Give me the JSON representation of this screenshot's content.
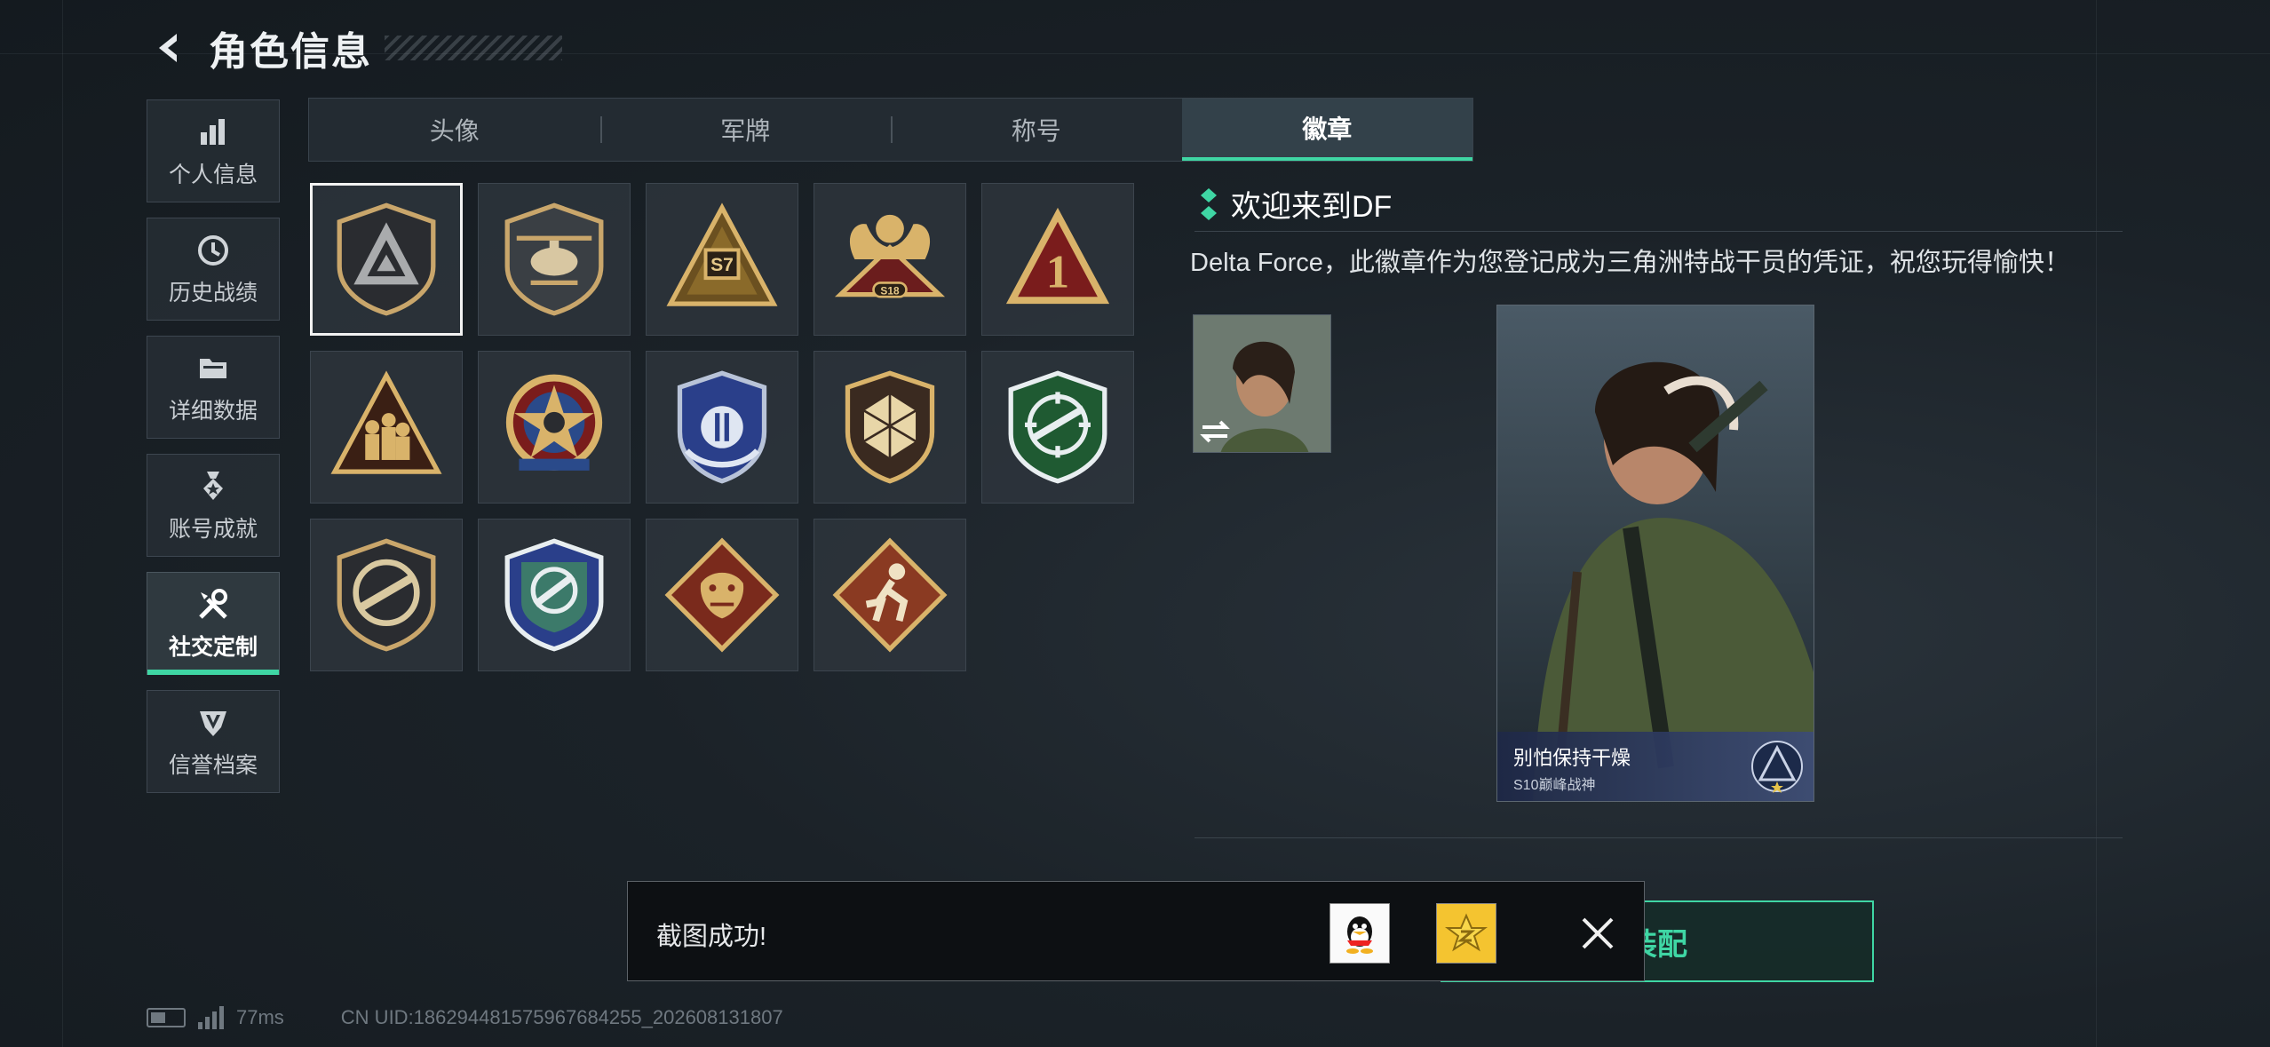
{
  "header": {
    "title": "角色信息"
  },
  "sidebar": {
    "items": [
      {
        "label": "个人信息",
        "icon": "bar-chart-icon",
        "active": false
      },
      {
        "label": "历史战绩",
        "icon": "clock-icon",
        "active": false
      },
      {
        "label": "详细数据",
        "icon": "folder-icon",
        "active": false
      },
      {
        "label": "账号成就",
        "icon": "medal-icon",
        "active": false
      },
      {
        "label": "社交定制",
        "icon": "tools-icon",
        "active": true
      },
      {
        "label": "信誉档案",
        "icon": "shield-v-icon",
        "active": false
      }
    ]
  },
  "tabs": [
    {
      "label": "头像",
      "active": false
    },
    {
      "label": "军牌",
      "active": false
    },
    {
      "label": "称号",
      "active": false
    },
    {
      "label": "徽章",
      "active": true
    }
  ],
  "badges": [
    {
      "icon": "triangle-shield-badge-icon",
      "selected": true
    },
    {
      "icon": "helicopter-badge-icon"
    },
    {
      "icon": "s7-badge-icon",
      "text": "S7"
    },
    {
      "icon": "s18-eagle-badge-icon",
      "text": "S18"
    },
    {
      "icon": "number-one-badge-icon",
      "text": "1"
    },
    {
      "icon": "soldiers-badge-icon"
    },
    {
      "icon": "star-wheel-badge-icon"
    },
    {
      "icon": "blue-wing-badge-icon"
    },
    {
      "icon": "d20-dice-badge-icon"
    },
    {
      "icon": "green-rifle-badge-icon"
    },
    {
      "icon": "rifle-circle-badge-icon"
    },
    {
      "icon": "blue-crosshair-badge-icon"
    },
    {
      "icon": "dragon-badge-icon"
    },
    {
      "icon": "runner-badge-icon"
    }
  ],
  "detail": {
    "title": "欢迎来到DF",
    "description": "Delta Force，此徽章作为您登记成为三角洲特战干员的凭证，祝您玩得愉快！",
    "card": {
      "name": "别怕保持干燥",
      "subtitle": "S10巅峰战神"
    }
  },
  "equip": {
    "label": "装配"
  },
  "toast": {
    "text": "截图成功!"
  },
  "status": {
    "ping": "77ms",
    "uid": "CN UID:1862944815759676842​55_202608131807"
  },
  "colors": {
    "accent": "#3fd6a4",
    "background": "#1b2228",
    "gold": "#c9a66b"
  }
}
